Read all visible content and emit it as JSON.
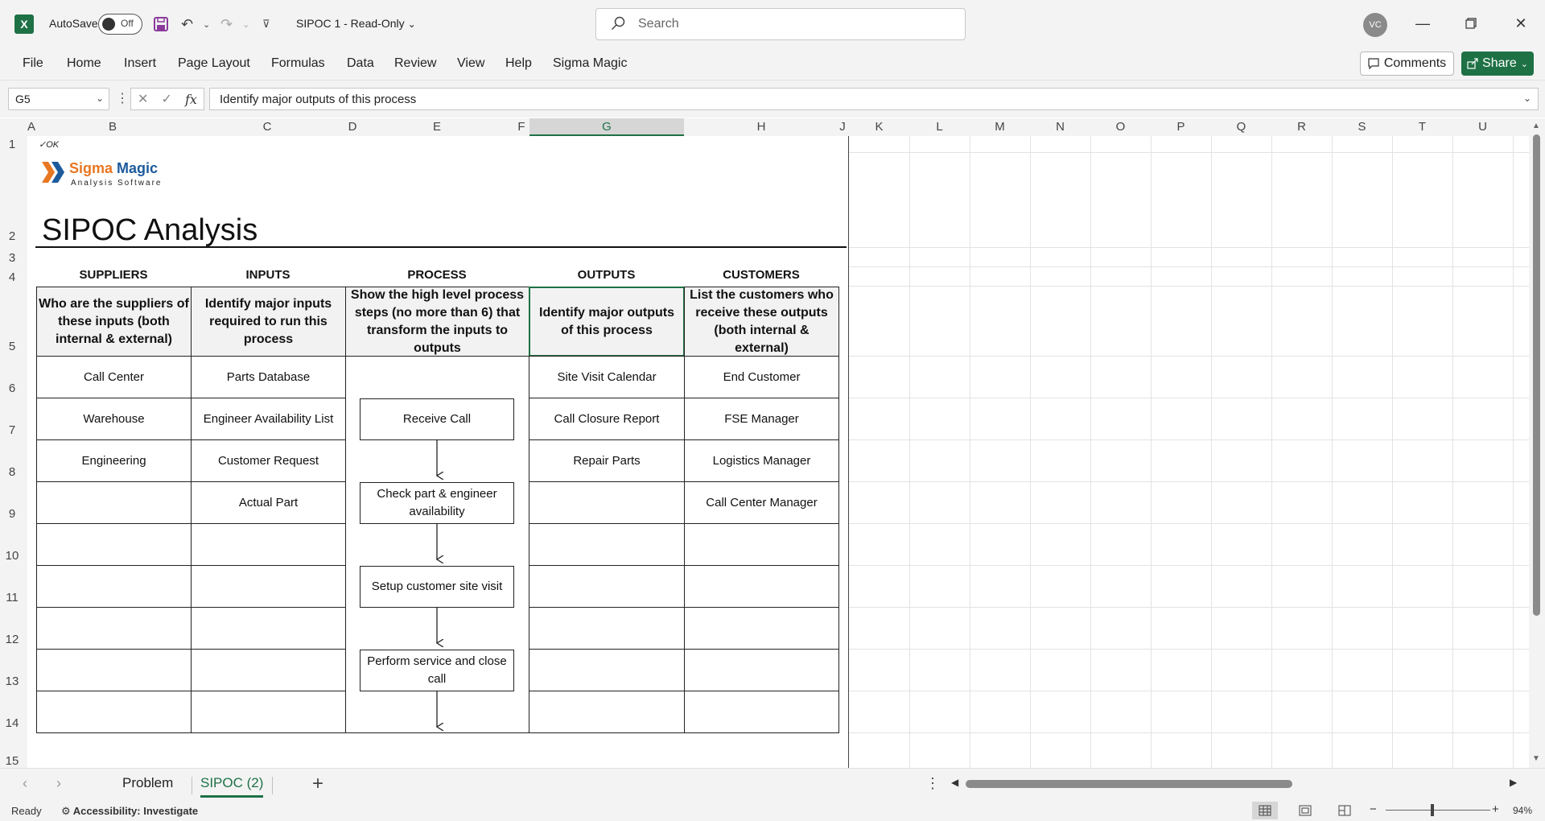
{
  "titlebar": {
    "autosave_label": "AutoSave",
    "autosave_state": "Off",
    "doc_title": "SIPOC 1  -  Read-Only",
    "search_placeholder": "Search",
    "user_initials": "VC"
  },
  "menu": {
    "items": [
      "File",
      "Home",
      "Insert",
      "Page Layout",
      "Formulas",
      "Data",
      "Review",
      "View",
      "Help",
      "Sigma Magic"
    ],
    "comments_label": "Comments",
    "share_label": "Share"
  },
  "formula_bar": {
    "name_box": "G5",
    "fx": "fx",
    "value": "Identify major outputs of this process"
  },
  "grid": {
    "columns": [
      "A",
      "B",
      "C",
      "D",
      "E",
      "F",
      "G",
      "H",
      "J",
      "K",
      "L",
      "M",
      "N",
      "O",
      "P",
      "Q",
      "R",
      "S",
      "T",
      "U"
    ],
    "rows": [
      "1",
      "2",
      "3",
      "4",
      "5",
      "6",
      "7",
      "8",
      "9",
      "10",
      "11",
      "12",
      "13",
      "14",
      "15"
    ],
    "selected_column": "G"
  },
  "sheet": {
    "ok_mark": "✓OK",
    "logo_word1": "Sigma",
    "logo_word2": "Magic",
    "logo_sub": "Analysis Software",
    "title": "SIPOC Analysis",
    "headers": {
      "suppliers": "SUPPLIERS",
      "inputs": "INPUTS",
      "process": "PROCESS",
      "outputs": "OUTPUTS",
      "customers": "CUSTOMERS"
    },
    "questions": {
      "suppliers": "Who are the suppliers of these inputs (both internal & external)",
      "inputs": "Identify major inputs required to run this process",
      "process": "Show the high level process steps (no more than 6) that transform the inputs to outputs",
      "outputs": "Identify major outputs of this process",
      "customers": "List the customers who receive these outputs (both internal & external)"
    },
    "suppliers": [
      "Call Center",
      "Warehouse",
      "Engineering",
      "",
      "",
      "",
      "",
      "",
      ""
    ],
    "inputs": [
      "Parts Database",
      "Engineer Availability List",
      "Customer Request",
      "Actual Part",
      "",
      "",
      "",
      "",
      ""
    ],
    "outputs": [
      "Site Visit Calendar",
      "Call Closure Report",
      "Repair Parts",
      "",
      "",
      "",
      "",
      "",
      ""
    ],
    "customers": [
      "End Customer",
      "FSE Manager",
      "Logistics Manager",
      "Call Center Manager",
      "",
      "",
      "",
      "",
      ""
    ],
    "process_steps": [
      "Receive Call",
      "Check part & engineer availability",
      "Setup customer site visit",
      "Perform service and close call"
    ]
  },
  "tabs": {
    "sheets": [
      "Problem",
      "SIPOC (2)"
    ],
    "active": "SIPOC (2)"
  },
  "status": {
    "ready": "Ready",
    "accessibility": "Accessibility: Investigate",
    "zoom": "94%"
  },
  "colors": {
    "excel_green": "#1e7145",
    "logo_orange": "#e87722",
    "logo_blue": "#1c5a9c"
  }
}
